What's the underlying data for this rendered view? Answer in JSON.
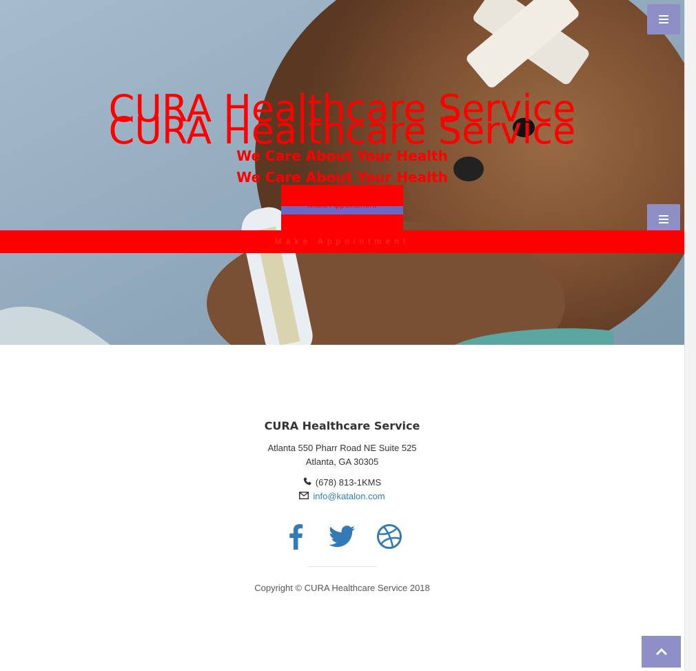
{
  "hero": {
    "title": "CURA Healthcare Service",
    "subtitle": "We Care About Your Health",
    "appointment_button_label": "Make Appointment"
  },
  "footer": {
    "title": "CURA Healthcare Service",
    "address_line1": "Atlanta 550 Pharr Road NE Suite 525",
    "address_line2": "Atlanta, GA 30305",
    "phone": "(678) 813-1KMS",
    "email": "info@katalon.com",
    "copyright": "Copyright © CURA Healthcare Service 2018"
  },
  "icons": {
    "menu": "menu-icon",
    "phone": "phone-icon",
    "email": "envelope-icon",
    "facebook": "facebook-icon",
    "twitter": "twitter-icon",
    "dribbble": "dribbble-icon",
    "to_top": "chevron-up-icon"
  },
  "colors": {
    "accent": "#8f8fc7",
    "link": "#337ab7",
    "overlay_text": "#ff0000",
    "social": "#337ab7"
  }
}
